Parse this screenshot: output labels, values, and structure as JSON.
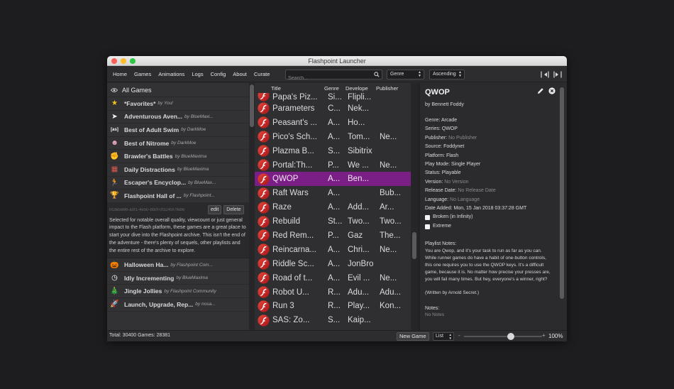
{
  "window": {
    "title": "Flashpoint Launcher"
  },
  "nav": [
    "Home",
    "Games",
    "Animations",
    "Logs",
    "Config",
    "About",
    "Curate"
  ],
  "search": {
    "placeholder": "Search..."
  },
  "filters": {
    "genre": "Genre",
    "order": "Ascending"
  },
  "sidebar": {
    "all_games": "All Games",
    "playlists_top": [
      {
        "title": "*Favorites*",
        "by": "by You!",
        "icon": "star-icon",
        "icon_glyph": "★",
        "icon_color": "#f0c419"
      },
      {
        "title": "Adventurous Aven...",
        "by": "by BlueMaxi...",
        "icon": "cursor-icon",
        "icon_glyph": "➤",
        "icon_color": "#ffffff"
      },
      {
        "title": "Best of Adult Swim",
        "by": "by DarkMoe",
        "icon": "adult-swim-icon",
        "icon_glyph": "[as]",
        "icon_color": "#ffffff"
      },
      {
        "title": "Best of Nitrome",
        "by": "by DarkMoe",
        "icon": "nitrome-icon",
        "icon_glyph": "☻",
        "icon_color": "#f2a6c4"
      },
      {
        "title": "Brawler's Battles",
        "by": "by BlueMaxima",
        "icon": "fist-icon",
        "icon_glyph": "✊",
        "icon_color": "#f3c18b"
      },
      {
        "title": "Daily Distractions",
        "by": "by BlueMaxima",
        "icon": "calendar-icon",
        "icon_glyph": "▦",
        "icon_color": "#e05a4f"
      },
      {
        "title": "Escaper's Encyclop...",
        "by": "by BlueMax...",
        "icon": "running-man-icon",
        "icon_glyph": "🏃",
        "icon_color": "#ffb74d"
      },
      {
        "title": "Flashpoint Hall of ...",
        "by": "by Flashpoint...",
        "icon": "trophy-icon",
        "icon_glyph": "🏆",
        "icon_color": "#e0b341"
      }
    ],
    "selected_playlist": {
      "id": "0cde5686-a0f1-4e50-8b0f-0f3245f7feb6",
      "edit": "edit",
      "delete": "Delete",
      "description": "Selected for notable overall quality, viewcount or just general impact to the Flash platform, these games are a great place to start your dive into the Flashpoint archive. This isn't the end of the adventure - there's plenty of sequels, other playlists and the entire rest of the archive to explore."
    },
    "playlists_bottom": [
      {
        "title": "Halloween Ha...",
        "by": "by Flashpoint Com...",
        "icon": "pumpkin-icon",
        "icon_glyph": "🎃",
        "icon_color": "#f57c00"
      },
      {
        "title": "Idly Incrementing",
        "by": "by BlueMaxima",
        "icon": "clock-icon",
        "icon_glyph": "◷",
        "icon_color": "#ffffff"
      },
      {
        "title": "Jingle Jollies",
        "by": "by Flashpoint Community",
        "icon": "tree-icon",
        "icon_glyph": "🎄",
        "icon_color": "#43a047"
      },
      {
        "title": "Launch, Upgrade, Rep...",
        "by": "by nosa...",
        "icon": "rocket-icon",
        "icon_glyph": "🚀",
        "icon_color": "#d35a9b"
      }
    ]
  },
  "list": {
    "headers": {
      "title": "Title",
      "genre": "Genre",
      "developer": "Develope",
      "publisher": "Publisher"
    },
    "clipped_row": {
      "title": "Papa's Piz...",
      "genre": "Si...",
      "developer": "Flipli...",
      "publisher": ""
    },
    "rows": [
      {
        "title": "Parameters",
        "genre": "C...",
        "developer": "Nek...",
        "publisher": ""
      },
      {
        "title": "Peasant's ...",
        "genre": "A...",
        "developer": "Ho...",
        "publisher": ""
      },
      {
        "title": "Pico's Sch...",
        "genre": "A...",
        "developer": "Tom...",
        "publisher": "Ne..."
      },
      {
        "title": "Plazma B...",
        "genre": "S...",
        "developer": "Sibitrix",
        "publisher": ""
      },
      {
        "title": "Portal:Th...",
        "genre": "P...",
        "developer": "We ...",
        "publisher": "Ne..."
      },
      {
        "title": "QWOP",
        "genre": "A...",
        "developer": "Ben...",
        "publisher": "",
        "selected": true
      },
      {
        "title": "Raft Wars",
        "genre": "A...",
        "developer": "",
        "publisher": "Bub..."
      },
      {
        "title": "Raze",
        "genre": "A...",
        "developer": "Add...",
        "publisher": "Ar..."
      },
      {
        "title": "Rebuild",
        "genre": "St...",
        "developer": "Two...",
        "publisher": "Two..."
      },
      {
        "title": "Red Rem...",
        "genre": "P...",
        "developer": "Gaz",
        "publisher": "The..."
      },
      {
        "title": "Reincarna...",
        "genre": "A...",
        "developer": "Chri...",
        "publisher": "Ne..."
      },
      {
        "title": "Riddle Sc...",
        "genre": "A...",
        "developer": "JonBro",
        "publisher": ""
      },
      {
        "title": "Road of t...",
        "genre": "A...",
        "developer": "Evil ...",
        "publisher": "Ne..."
      },
      {
        "title": "Robot U...",
        "genre": "R...",
        "developer": "Adu...",
        "publisher": "Adu..."
      },
      {
        "title": "Run 3",
        "genre": "R...",
        "developer": "Play...",
        "publisher": "Kon..."
      },
      {
        "title": "SAS: Zo...",
        "genre": "S...",
        "developer": "Kaip...",
        "publisher": ""
      }
    ]
  },
  "detail": {
    "title": "QWOP",
    "author": "by Bennett Foddy",
    "fields": [
      {
        "label": "Genre:",
        "value": "Arcade",
        "muted": false
      },
      {
        "label": "Series:",
        "value": "QWOP",
        "muted": false
      },
      {
        "label": "Publisher:",
        "value": "No Publisher",
        "muted": true
      },
      {
        "label": "Source:",
        "value": "Foddynet",
        "muted": false
      },
      {
        "label": "Platform:",
        "value": "Flash",
        "muted": false
      },
      {
        "label": "Play Mode:",
        "value": "Single Player",
        "muted": false
      },
      {
        "label": "Status:",
        "value": "Playable",
        "muted": false
      },
      {
        "label": "Version:",
        "value": "No Version",
        "muted": true
      },
      {
        "label": "Release Date:",
        "value": "No Release Date",
        "muted": true
      },
      {
        "label": "Language:",
        "value": "No Language",
        "muted": true
      },
      {
        "label": "Date Added:",
        "value": "Mon, 15 Jan 2018 03:37:28 GMT",
        "muted": false
      }
    ],
    "checkboxes": [
      "Broken (in Infinity)",
      "Extreme"
    ],
    "playlist_notes_label": "Playlist Notes:",
    "playlist_notes": "You are Qwop, and it's your task to run as far as you can. While runner games do have a habit of one-button controls, this one requires you to use the QWOP keys. It's a difficult game, because it is. No matter how precise your presses are, you will fail many times. But hey, everyone's a winner, right?",
    "written": "(Written by Arnold Secret.)",
    "notes_label": "Notes:",
    "notes": "No Notes"
  },
  "footer": {
    "total": "Total: 30400 Games: 28381",
    "new_game": "New Game",
    "layout": "List",
    "minus": "-",
    "plus": "+",
    "zoom": "100%",
    "zoom_level": 0.55
  }
}
